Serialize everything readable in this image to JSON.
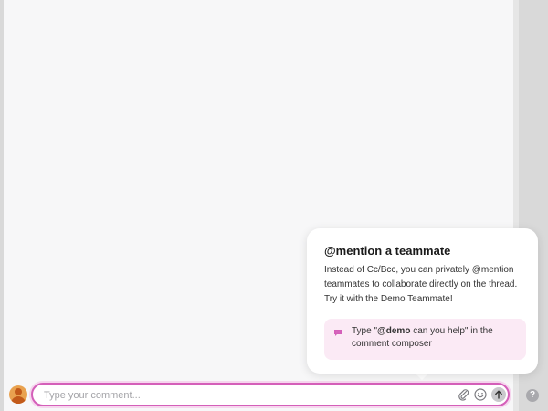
{
  "composer": {
    "placeholder": "Type your comment..."
  },
  "popover": {
    "title": "@mention a teammate",
    "body": "Instead of Cc/Bcc, you can privately @mention teammates to collaborate directly on the thread. Try it with the Demo Teammate!",
    "hint_prefix": "Type \"",
    "hint_bold": "@demo",
    "hint_suffix": " can you help\" in the comment composer"
  },
  "icons": {
    "attach": "paperclip-icon",
    "emoji": "smiley-icon",
    "send": "arrow-up-icon",
    "help": "question-mark-icon",
    "hint": "chat-bubble-icon"
  },
  "help": {
    "label": "?"
  },
  "colors": {
    "accent": "#d45fb9",
    "hint_bg": "#fbeaf5",
    "avatar": "#e9a24f"
  }
}
